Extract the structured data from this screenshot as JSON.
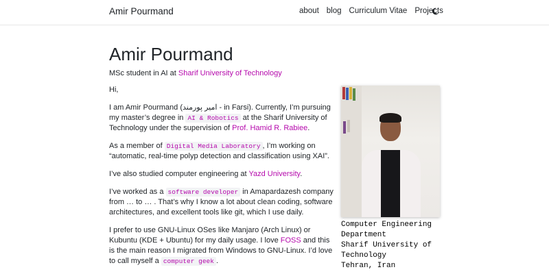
{
  "nav": {
    "brand": "Amir Pourmand",
    "items": [
      {
        "label": "about"
      },
      {
        "label": "blog"
      },
      {
        "label": "Curriculum Vitae"
      },
      {
        "label": "Projects"
      }
    ],
    "theme_icon": "moon-icon"
  },
  "header": {
    "title": "Amir Pourmand",
    "subtitle_prefix": "MSc student in AI at ",
    "subtitle_link": "Sharif University of Technology"
  },
  "body": {
    "greeting": "Hi,",
    "p1_a": "I am Amir Pourmand (امیر پورمند - in Farsi). Currently, I’m pursuing my master’s degree in ",
    "p1_code": "AI & Robotics",
    "p1_b": " at the Sharif University of Technology under the supervision of ",
    "p1_link": "Prof. Hamid R. Rabiee",
    "p1_c": ".",
    "p2_a": "As a member of ",
    "p2_code": "Digital Media Laboratory",
    "p2_b": ", I’m working on “automatic, real-time polyp detection and classification using XAI”.",
    "p3_a": "I’ve also studied computer engineering at ",
    "p3_link": "Yazd University",
    "p3_b": ".",
    "p4_a": "I’ve worked as a ",
    "p4_code": "software developer",
    "p4_b": " in Amapardazesh company from … to … . That’s why I know a lot about clean coding, software architectures, and excellent tools like git, which I use daily.",
    "p5_a": "I prefer to use GNU-Linux OSes like Manjaro (Arch Linux) or Kubuntu (KDE + Ubuntu) for my daily usage. I love ",
    "p5_link": "FOSS",
    "p5_b": " and this is the main reason I migrated from Windows to GNU-Linux. I’d love to call myself a ",
    "p5_code": "computer geek",
    "p5_c": "."
  },
  "profile": {
    "caption": [
      "Computer Engineering",
      "Department",
      "Sharif University of",
      "Technology",
      "Tehran, Iran"
    ]
  },
  "colors": {
    "accent": "#b509ac",
    "text": "#212529",
    "code_bg": "#f2f3f5"
  }
}
